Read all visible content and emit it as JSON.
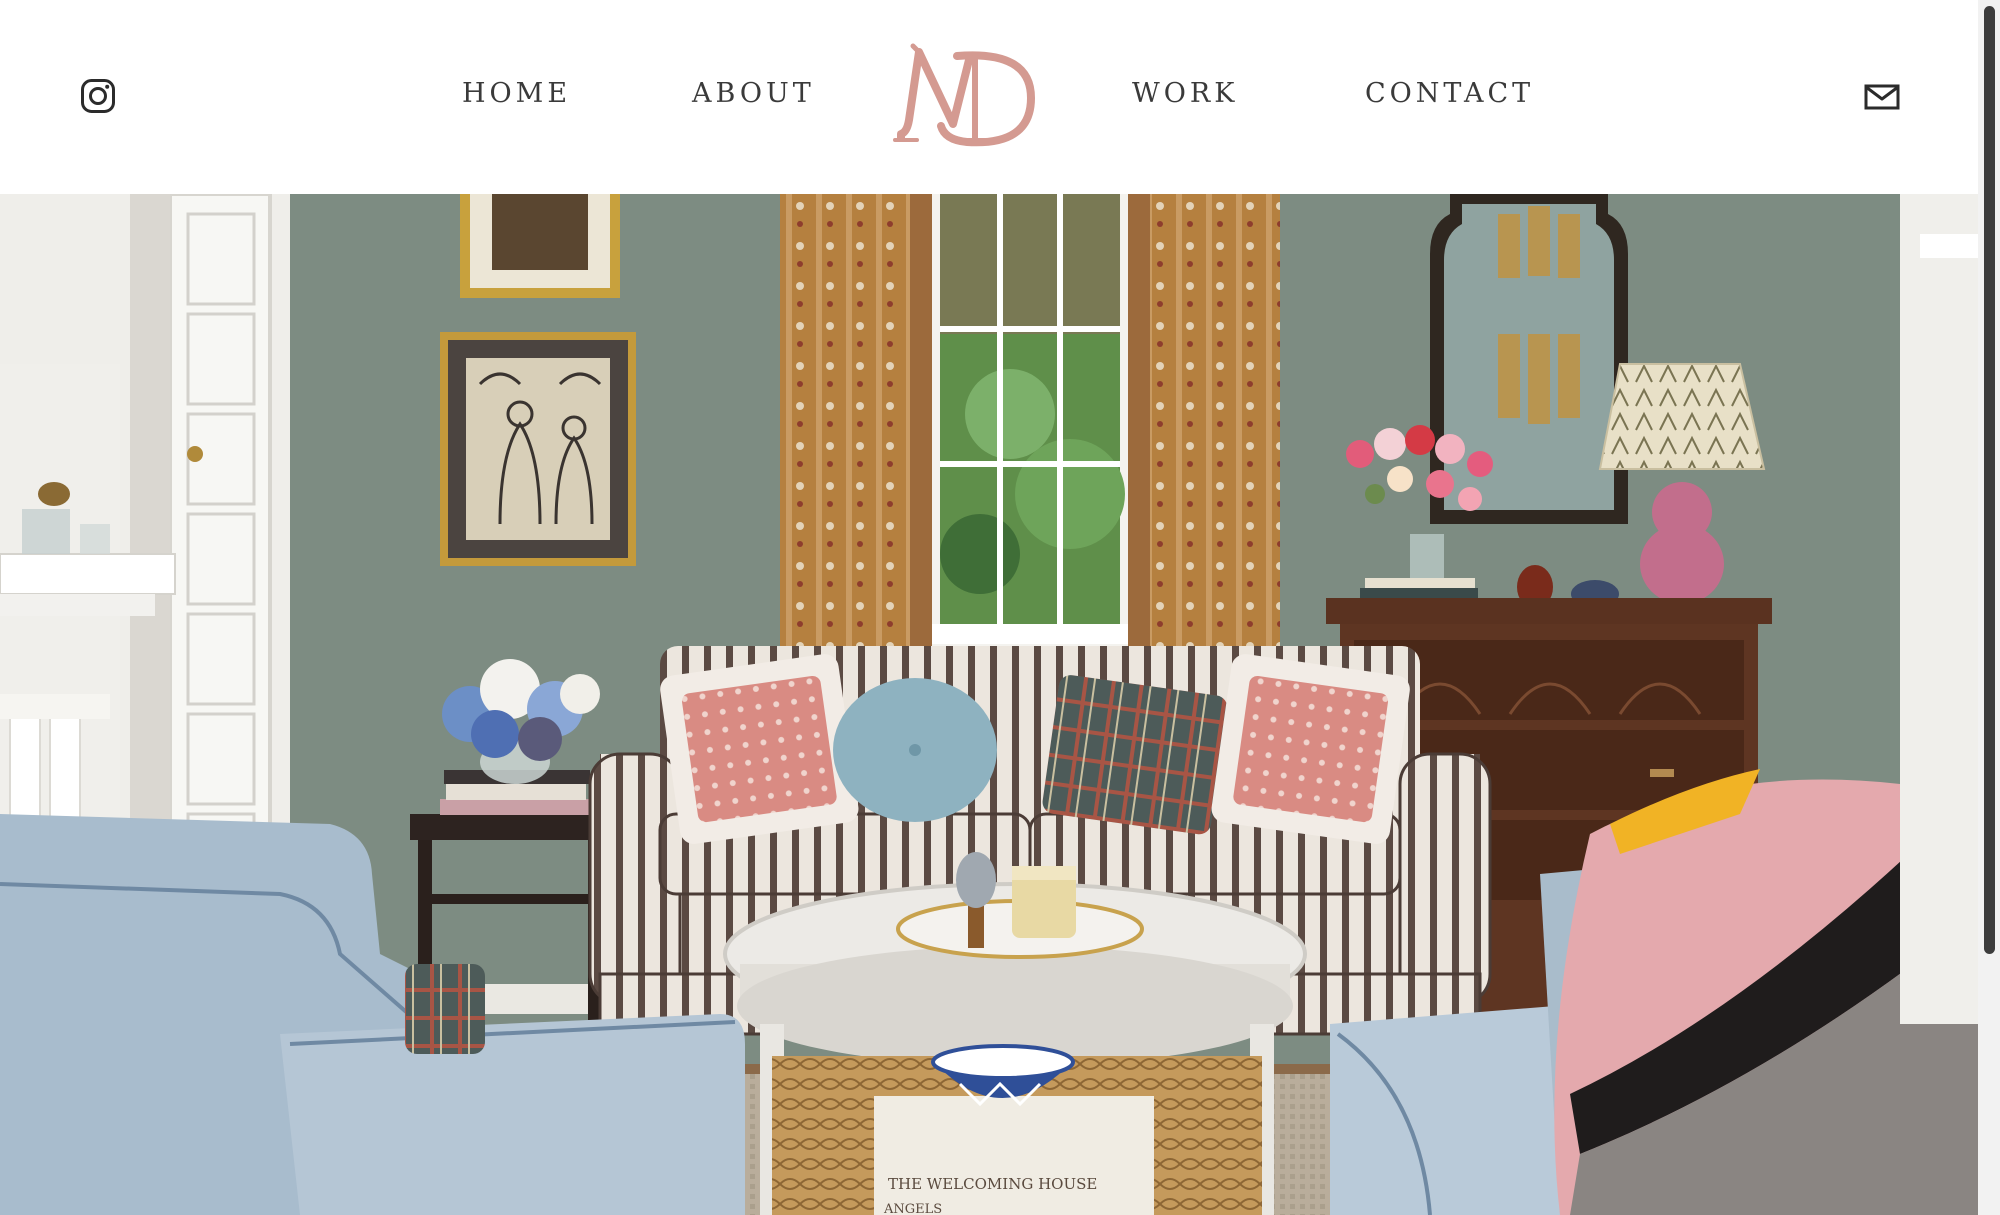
{
  "nav": {
    "left": [
      {
        "label": "HOME"
      },
      {
        "label": "ABOUT"
      }
    ],
    "right": [
      {
        "label": "WORK"
      },
      {
        "label": "CONTACT"
      }
    ],
    "logo_text": "MD",
    "icons": {
      "social": "instagram-icon",
      "mail": "mail-icon"
    }
  },
  "hero": {
    "book_titles": [
      "THE WELCOMING HOUSE",
      "ANGELS"
    ]
  },
  "colors": {
    "logo": "#d49a91",
    "nav_text": "#3a3a3a",
    "wall": "#7c8c82",
    "curtain": "#b07a3a",
    "sofa_stripe": "#5a4a44",
    "chair": "#a9bccb",
    "pillow_pink": "#d98b83",
    "dresser": "#5a3220"
  }
}
